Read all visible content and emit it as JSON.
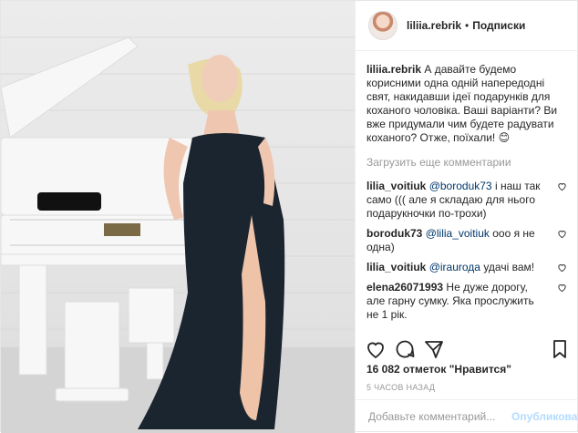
{
  "post": {
    "photo_alt": "",
    "author": {
      "username": "liliia.rebrik",
      "follow_label": "Подписки"
    },
    "caption": {
      "username": "liliia.rebrik",
      "text": "А давайте будемо корисними одна одній напередодні свят, накидавши ідеї подарунків для коханого чоловіка. Ваші варіанти? Ви вже придумали чим будете радувати коханого? Отже, поїхали!",
      "emoji": "😊"
    },
    "load_more_label": "Загрузить еще комментарии",
    "comments": [
      {
        "user": "lilia_voitiuk",
        "mention": "@boroduk73",
        "text": " і наш так само ((( але я складаю для нього подарукночки по-трохи)"
      },
      {
        "user": "boroduk73",
        "mention": "@lilia_voitiuk",
        "text": " ооо я не одна)"
      },
      {
        "user": "lilia_voitiuk",
        "mention": "@iraurода",
        "text": " удачі вам!"
      },
      {
        "user": "elena26071993",
        "mention": "",
        "text": "Не дуже дорогу, але гарну сумку. Яка прослужить не 1 рік."
      }
    ],
    "likes_label": "16 082 отметок \"Нравится\"",
    "time_label": "5 ЧАСОВ НАЗАД",
    "comment_placeholder": "Добавьте комментарий...",
    "publish_label": "Опубликовать"
  },
  "colors": {
    "mention": "#00376b",
    "muted": "#999999",
    "publish": "#b3dbff",
    "dress": "#1b2530"
  }
}
